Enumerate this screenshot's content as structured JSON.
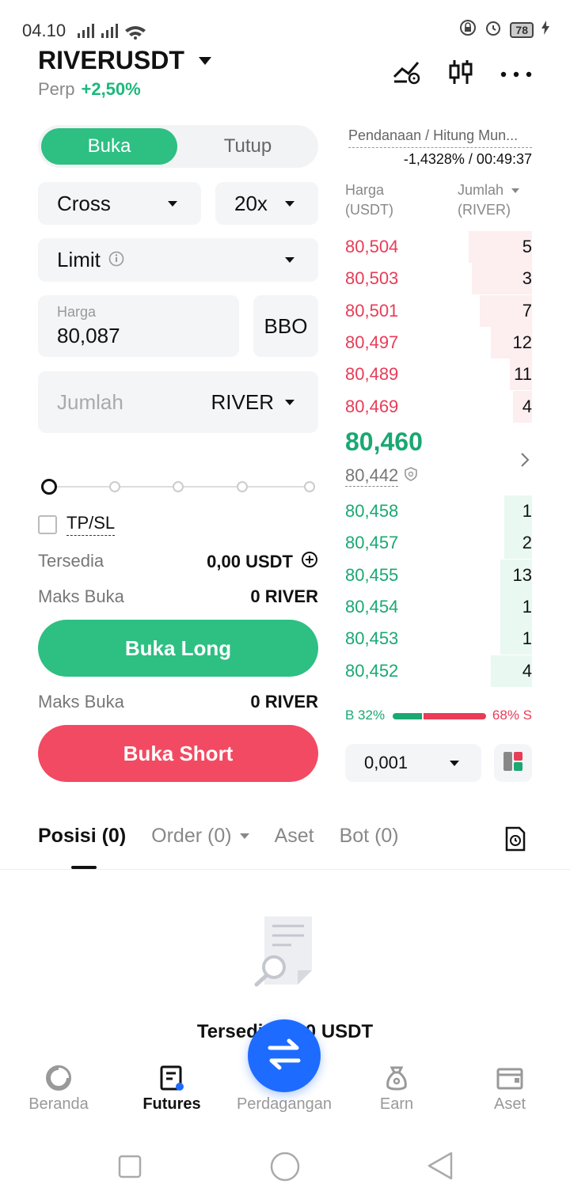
{
  "status_bar": {
    "time": "04.10",
    "battery": "78"
  },
  "header": {
    "pair": "RIVERUSDT",
    "type": "Perp",
    "change": "+2,50%"
  },
  "order_form": {
    "tabs": [
      "Buka",
      "Tutup"
    ],
    "margin_mode": "Cross",
    "leverage": "20x",
    "order_type": "Limit",
    "price_label": "Harga",
    "price_value": "80,087",
    "bbo_label": "BBO",
    "amount_placeholder": "Jumlah",
    "amount_unit": "RIVER",
    "tpsl_label": "TP/SL",
    "available_label": "Tersedia",
    "available_value": "0,00 USDT",
    "max_open_label": "Maks Buka",
    "max_open_long": "0 RIVER",
    "max_open_short": "0 RIVER",
    "long_button": "Buka Long",
    "short_button": "Buka Short"
  },
  "order_book": {
    "funding_label": "Pendanaan / Hitung Mun...",
    "funding_value": "-1,4328% / 00:49:37",
    "price_header_1": "Harga",
    "price_header_2": "(USDT)",
    "qty_header_1": "Jumlah",
    "qty_header_2": "(RIVER)",
    "asks": [
      {
        "price": "80,504",
        "qty": "5",
        "depth": 0.34
      },
      {
        "price": "80,503",
        "qty": "3",
        "depth": 0.32
      },
      {
        "price": "80,501",
        "qty": "7",
        "depth": 0.28
      },
      {
        "price": "80,497",
        "qty": "12",
        "depth": 0.22
      },
      {
        "price": "80,489",
        "qty": "11",
        "depth": 0.12
      },
      {
        "price": "80,469",
        "qty": "4",
        "depth": 0.1
      }
    ],
    "last_price": "80,460",
    "mark_price": "80,442",
    "bids": [
      {
        "price": "80,458",
        "qty": "1",
        "depth": 0.15
      },
      {
        "price": "80,457",
        "qty": "2",
        "depth": 0.15
      },
      {
        "price": "80,455",
        "qty": "13",
        "depth": 0.17
      },
      {
        "price": "80,454",
        "qty": "1",
        "depth": 0.17
      },
      {
        "price": "80,453",
        "qty": "1",
        "depth": 0.17
      },
      {
        "price": "80,452",
        "qty": "4",
        "depth": 0.22
      }
    ],
    "buy_ratio_label": "B 32%",
    "sell_ratio_label": "68% S",
    "buy_ratio": 0.32,
    "depth_step": "0,001"
  },
  "tabs": {
    "positions": "Posisi (0)",
    "orders": "Order (0)",
    "assets": "Aset",
    "bots": "Bot (0)"
  },
  "empty_state": "Tersedia 0,00 USDT",
  "bottom_nav": {
    "home": "Beranda",
    "futures": "Futures",
    "trade": "Perdagangan",
    "earn": "Earn",
    "assets": "Aset"
  },
  "colors": {
    "green": "#2ebf83",
    "red": "#f24a62",
    "blue": "#1e6bff"
  }
}
